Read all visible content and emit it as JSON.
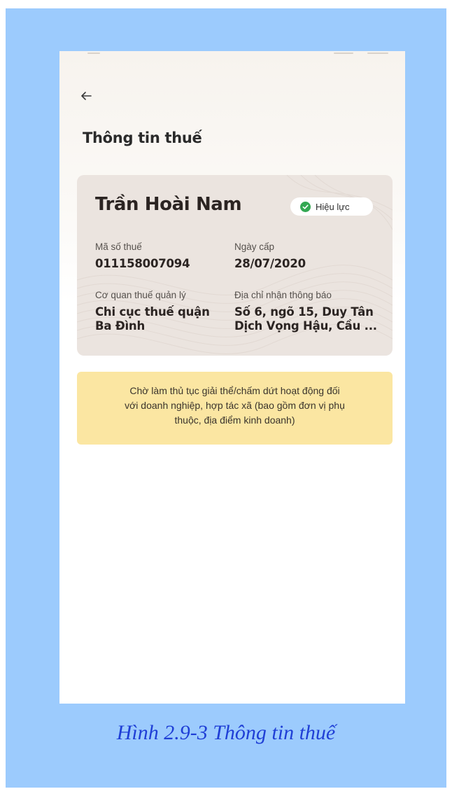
{
  "screen": {
    "title": "Thông tin thuế",
    "back_icon": "arrow-left-icon"
  },
  "tax_card": {
    "name": "Trần Hoài Nam",
    "status": {
      "label": "Hiệu lực",
      "icon": "check-circle-icon",
      "color": "#34a853"
    },
    "fields": {
      "tax_code_label": "Mã số thuế",
      "tax_code": "011158007094",
      "issue_date_label": "Ngày cấp",
      "issue_date": "28/07/2020",
      "authority_label": "Cơ quan thuế quản lý",
      "authority_line1": "Chi cục thuế quận",
      "authority_line2": "Ba Đình",
      "address_label": "Địa chỉ nhận thông báo",
      "address_line1": "Số 6, ngõ 15, Duy Tân",
      "address_line2": "Dịch Vọng Hậu, Cầu ..."
    }
  },
  "notice": {
    "line1": "Chờ làm thủ tục giải thể/chấm dứt hoạt động đối",
    "line2": "với doanh nghiệp, hợp tác xã (bao gồm đơn vị phụ",
    "line3": "thuộc, địa điểm kinh doanh)",
    "color": "#fbe6a2"
  },
  "caption": "Hình 2.9-3 Thông tin thuế",
  "colors": {
    "frame": "#9ccbfd",
    "caption": "#1f3fd6",
    "card": "#ebe4df"
  }
}
